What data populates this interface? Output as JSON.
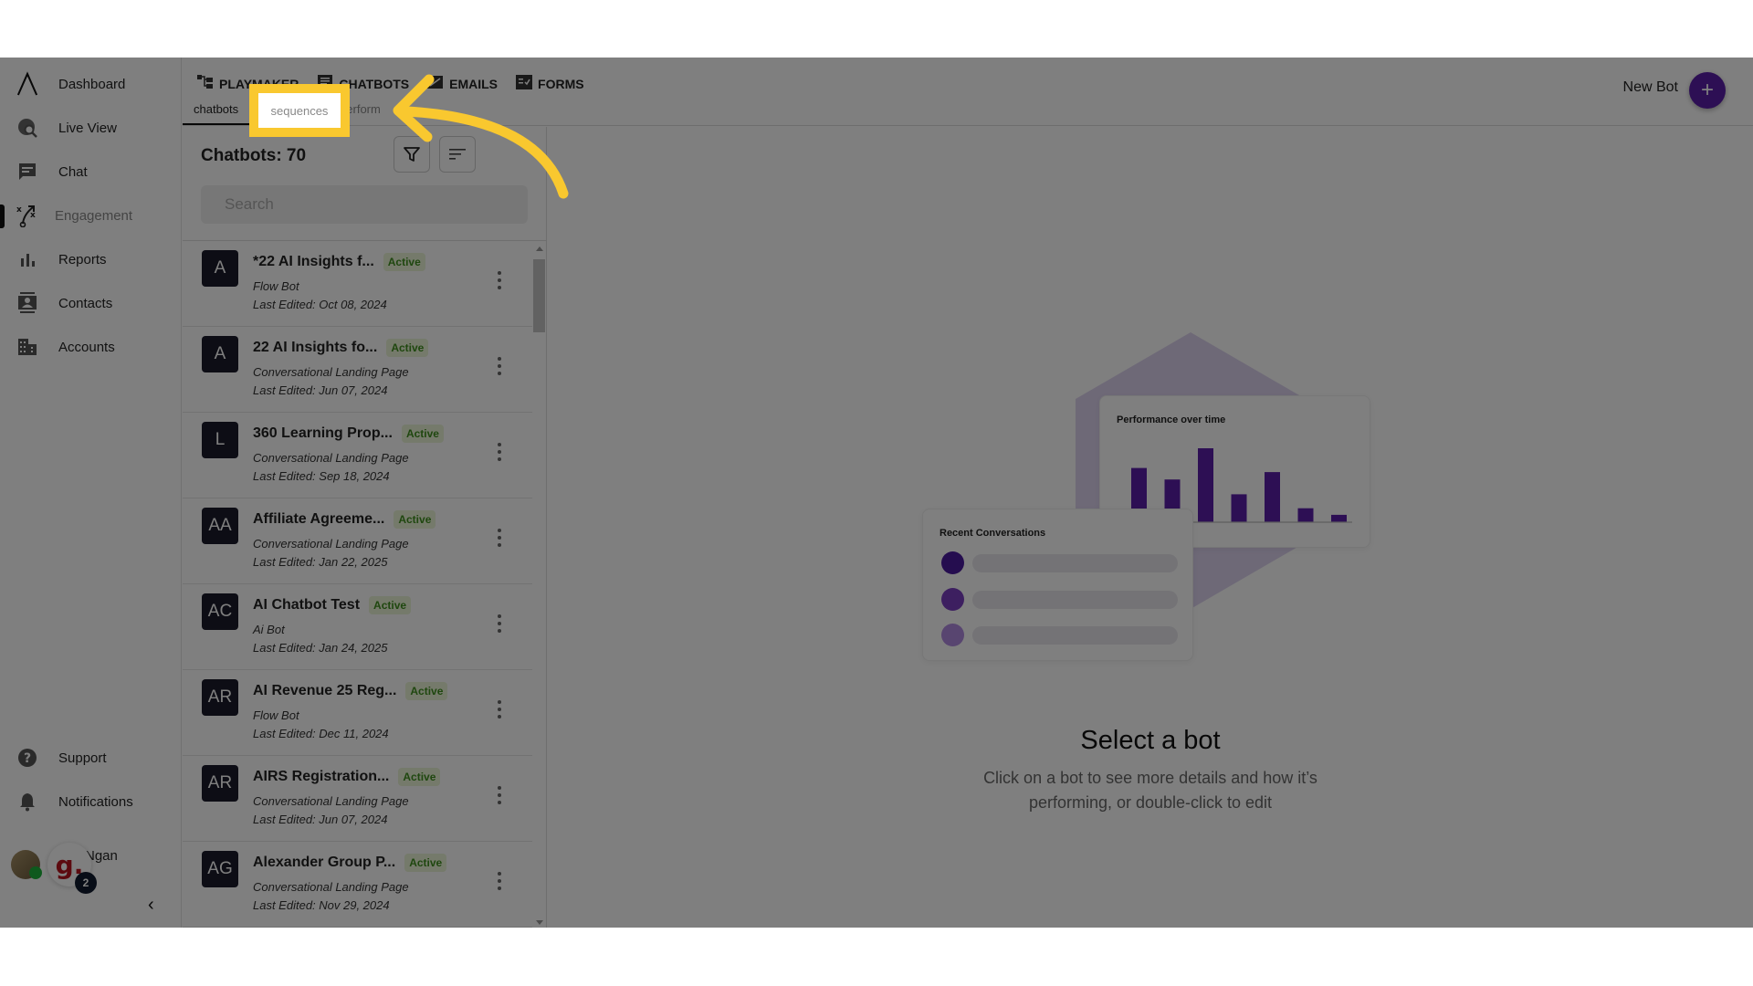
{
  "sidebar": {
    "items": [
      {
        "label": "Dashboard",
        "icon": "logo-caret-icon"
      },
      {
        "label": "Live View",
        "icon": "globe-search-icon"
      },
      {
        "label": "Chat",
        "icon": "chat-bubble-icon"
      },
      {
        "label": "Engagement",
        "icon": "playbook-icon",
        "active": true
      },
      {
        "label": "Reports",
        "icon": "bar-chart-icon"
      },
      {
        "label": "Contacts",
        "icon": "contact-card-icon"
      },
      {
        "label": "Accounts",
        "icon": "building-icon"
      }
    ],
    "bottom": [
      {
        "label": "Support",
        "icon": "help-circle-icon"
      },
      {
        "label": "Notifications",
        "icon": "bell-icon"
      }
    ],
    "user": {
      "name": "Ngan",
      "badge_letter": "g.",
      "notification_count": "2"
    },
    "collapse_glyph": "‹"
  },
  "header": {
    "main_tabs": [
      {
        "label": "PLAYMAKER",
        "icon": "playmaker-icon"
      },
      {
        "label": "CHATBOTS",
        "icon": "chatbot-icon"
      },
      {
        "label": "EMAILS",
        "icon": "email-icon"
      },
      {
        "label": "FORMS",
        "icon": "form-icon"
      }
    ],
    "sub_tabs": [
      {
        "label": "chatbots",
        "active": true
      },
      {
        "label": "sequences"
      },
      {
        "label": "perform"
      }
    ],
    "new_bot_label": "New Bot",
    "plus_glyph": "+"
  },
  "list_panel": {
    "title": "Chatbots: 70",
    "search_placeholder": "Search",
    "status_label": "Active",
    "bots": [
      {
        "initials": "A",
        "name": "*22 AI Insights f...",
        "type": "Flow Bot",
        "edited": "Last Edited: Oct 08, 2024",
        "status": "Active"
      },
      {
        "initials": "A",
        "name": "22 AI Insights fo...",
        "type": "Conversational Landing Page",
        "edited": "Last Edited: Jun 07, 2024",
        "status": "Active"
      },
      {
        "initials": "L",
        "name": "360 Learning Prop...",
        "type": "Conversational Landing Page",
        "edited": "Last Edited: Sep 18, 2024",
        "status": "Active"
      },
      {
        "initials": "AA",
        "name": "Affiliate Agreeme...",
        "type": "Conversational Landing Page",
        "edited": "Last Edited: Jan 22, 2025",
        "status": "Active"
      },
      {
        "initials": "AC",
        "name": "AI Chatbot Test",
        "type": "Ai Bot",
        "edited": "Last Edited: Jan 24, 2025",
        "status": "Active"
      },
      {
        "initials": "AR",
        "name": "AI Revenue 25 Reg...",
        "type": "Flow Bot",
        "edited": "Last Edited: Dec 11, 2024",
        "status": "Active"
      },
      {
        "initials": "AR",
        "name": "AIRS Registration...",
        "type": "Conversational Landing Page",
        "edited": "Last Edited: Jun 07, 2024",
        "status": "Active"
      },
      {
        "initials": "AG",
        "name": "Alexander Group P...",
        "type": "Conversational Landing Page",
        "edited": "Last Edited: Nov 29, 2024",
        "status": "Active"
      }
    ]
  },
  "empty_state": {
    "performance_card_title": "Performance over time",
    "performance_bars": [
      0.66,
      0.52,
      0.9,
      0.34,
      0.61,
      0.17,
      0.09
    ],
    "recent_card_title": "Recent Conversations",
    "title": "Select a bot",
    "description": "Click on a bot to see more details and how it’s performing, or double-click to edit"
  },
  "annotation": {
    "highlighted_label": "sequences",
    "color": "#f9c82f"
  },
  "colors": {
    "brand_purple": "#5b1fa8",
    "active_badge_bg": "#eaf5d6",
    "active_badge_text": "#3e8e1e"
  }
}
